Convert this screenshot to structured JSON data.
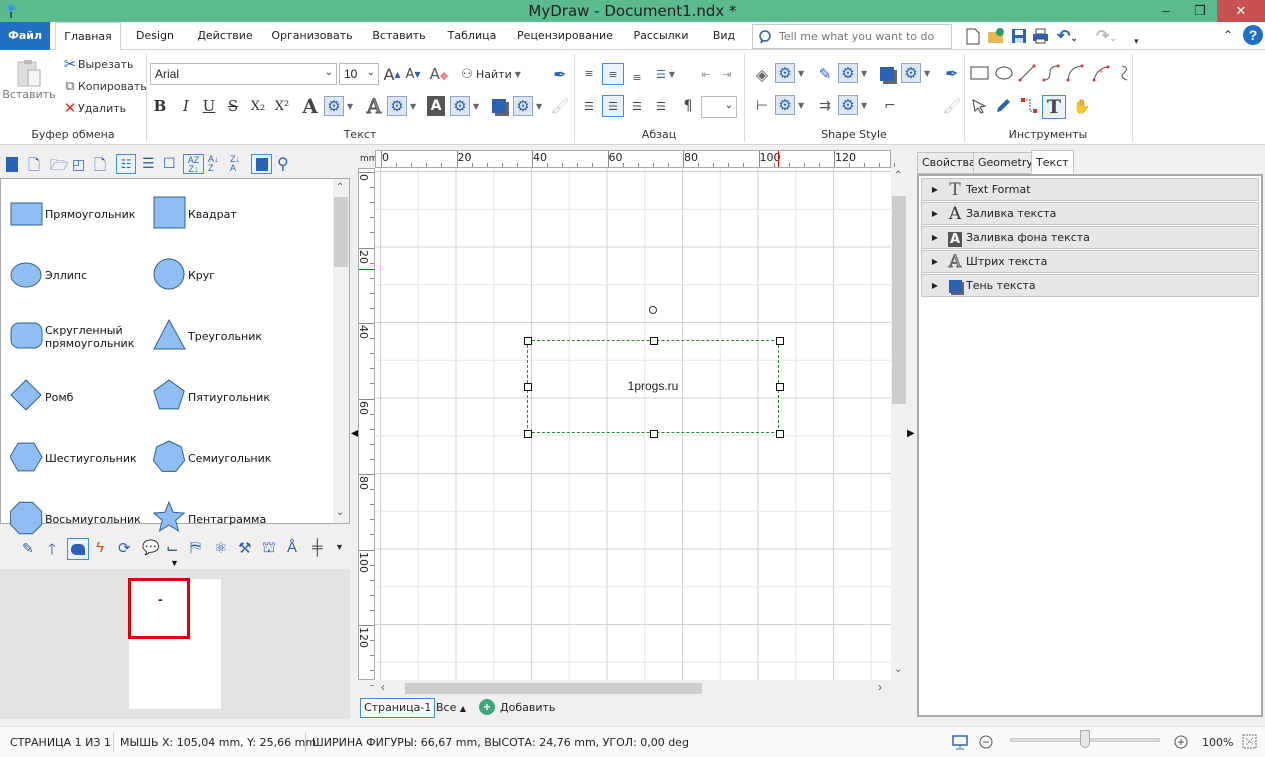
{
  "window": {
    "title": "MyDraw - Document1.ndx *",
    "controls": {
      "minimize": "–",
      "restore": "❐",
      "close": "✕"
    }
  },
  "ribbon_tabs": [
    {
      "label": "Файл"
    },
    {
      "label": "Главная"
    },
    {
      "label": "Design"
    },
    {
      "label": "Действие"
    },
    {
      "label": "Организовать"
    },
    {
      "label": "Вставить"
    },
    {
      "label": "Таблица"
    },
    {
      "label": "Рецензирование"
    },
    {
      "label": "Рассылки"
    },
    {
      "label": "Вид"
    }
  ],
  "search": {
    "placeholder": "Tell me what you want to do"
  },
  "clipboard": {
    "paste": "Вставить",
    "cut": "Вырезать",
    "copy": "Копировать",
    "delete": "Удалить",
    "group_label": "Буфер обмена"
  },
  "text_group": {
    "font": "Arial",
    "size": "10",
    "find": "Найти",
    "bold": "B",
    "italic": "I",
    "underline": "U",
    "strike": "S",
    "subscript": "X₂",
    "superscript": "X²",
    "group_label": "Текст"
  },
  "paragraph_group": {
    "group_label": "Абзац",
    "pilcrow": "¶",
    "spacing_value": ""
  },
  "shape_style_group": {
    "group_label": "Shape Style"
  },
  "tools_group": {
    "group_label": "Инструменты"
  },
  "shapes": [
    {
      "label": "Прямоугольник",
      "shape": "rect"
    },
    {
      "label": "Квадрат",
      "shape": "square"
    },
    {
      "label": "Эллипс",
      "shape": "ellipse"
    },
    {
      "label": "Круг",
      "shape": "circle"
    },
    {
      "label": "Скругленный прямоугольник",
      "shape": "roundrect"
    },
    {
      "label": "Треугольник",
      "shape": "triangle"
    },
    {
      "label": "Ромб",
      "shape": "diamond"
    },
    {
      "label": "Пятиугольник",
      "shape": "pentagon"
    },
    {
      "label": "Шестиугольник",
      "shape": "hexagon"
    },
    {
      "label": "Семиугольник",
      "shape": "heptagon"
    },
    {
      "label": "Восьмиугольник",
      "shape": "octagon"
    },
    {
      "label": "Пентаграмма",
      "shape": "star"
    }
  ],
  "thumbnail": {
    "marker": "-"
  },
  "rulers": {
    "unit": "mm",
    "top_labels": [
      "0",
      "20",
      "40",
      "60",
      "80",
      "100",
      "120"
    ],
    "left_labels": [
      "0",
      "20",
      "40",
      "60",
      "80",
      "100",
      "120"
    ]
  },
  "canvas": {
    "shape_text": "1progs.ru",
    "accent_selection": "#2a8a2a"
  },
  "page_tabs": {
    "current": "Страница-1",
    "all": "Все",
    "add": "Добавить"
  },
  "right_panel": {
    "tabs": [
      {
        "label": "Свойства"
      },
      {
        "label": "Geometry"
      },
      {
        "label": "Текст"
      }
    ],
    "sections": [
      {
        "label": "Text Format",
        "icon": "T"
      },
      {
        "label": "Заливка текста",
        "icon": "A"
      },
      {
        "label": "Заливка фона текста",
        "icon": "A"
      },
      {
        "label": "Штрих текста",
        "icon": "A"
      },
      {
        "label": "Тень текста",
        "icon": "■"
      }
    ]
  },
  "status": {
    "page": "СТРАНИЦА 1 ИЗ 1",
    "mouse": "МЫШЬ X: 105,04 mm, Y: 25,66 mm",
    "shape": "ШИРИНА ФИГУРЫ: 66,67 mm, ВЫСОТА: 24,76 mm, УГОЛ: 0,00 deg",
    "zoom": "100%",
    "zoom_slider_fraction": 0.5
  },
  "colors": {
    "titlebar": "#5bbb8d",
    "file_tab": "#1f6fc5",
    "close_button": "#c75050",
    "shape_fill": "#8fbff2",
    "shape_stroke": "#2f5f95"
  }
}
